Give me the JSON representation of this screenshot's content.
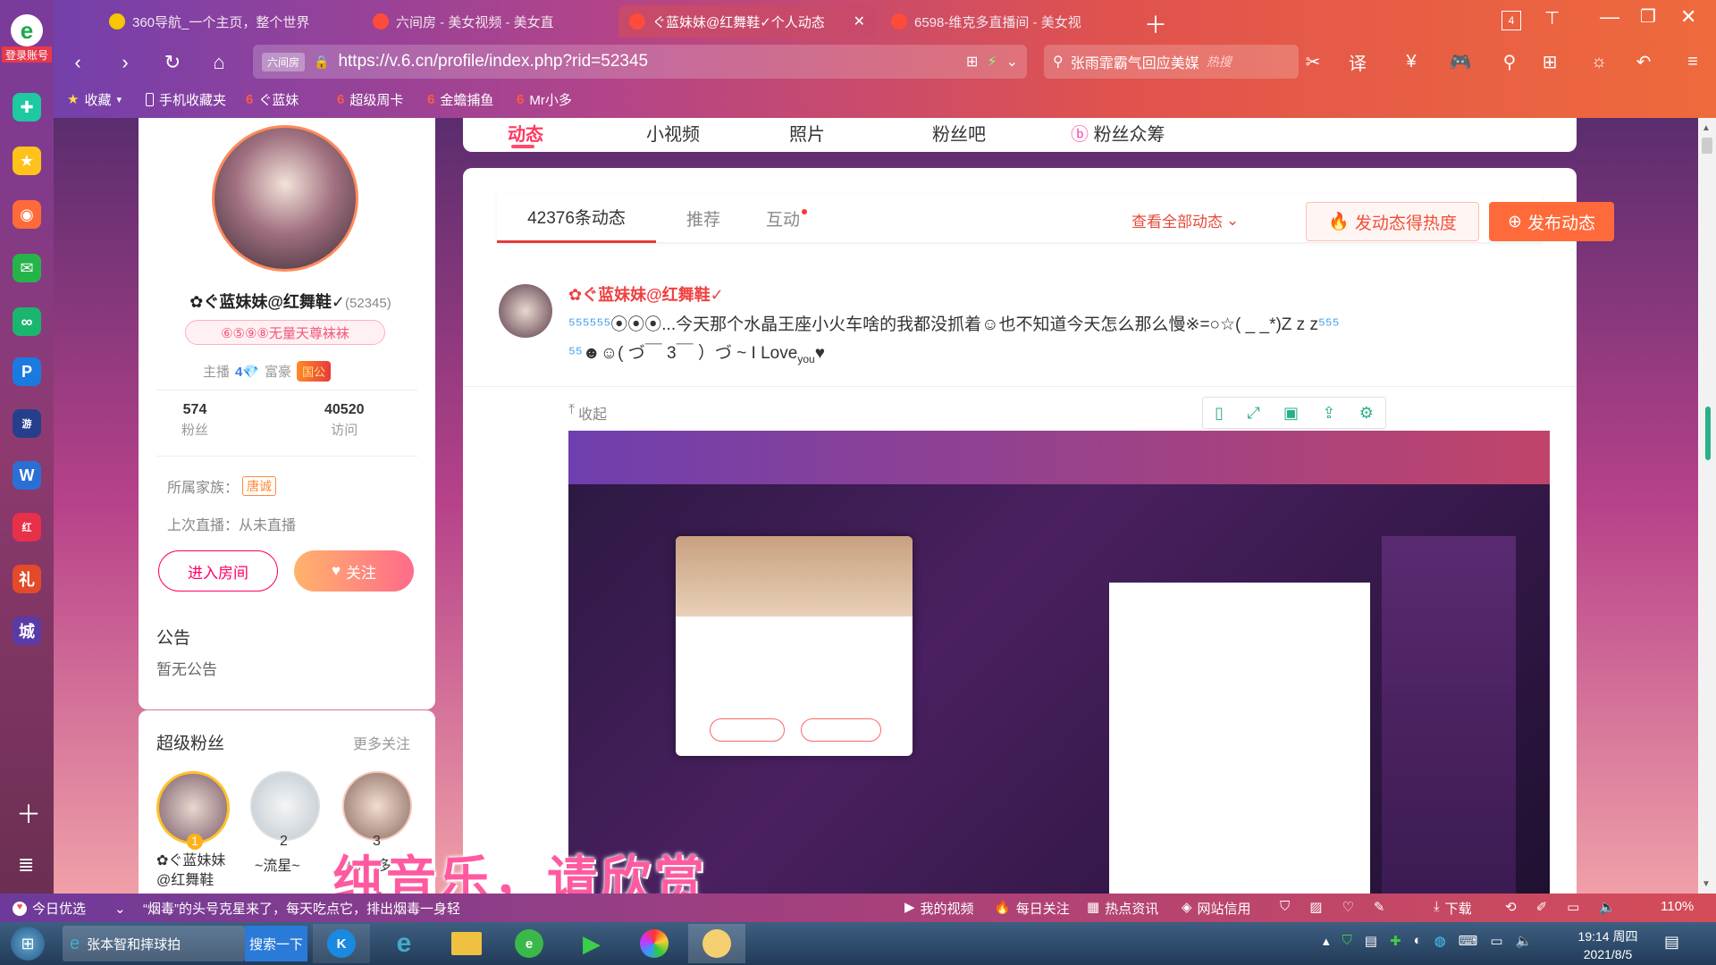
{
  "browser": {
    "login_label": "登录账号",
    "tabs": [
      {
        "title": "360导航_一个主页，整个世界"
      },
      {
        "title": "六间房 - 美女视频 - 美女直"
      },
      {
        "title": "ぐ蓝妹妹@红舞鞋✓个人动态"
      },
      {
        "title": "6598-维克多直播间 - 美女视"
      }
    ],
    "tab_count": "4",
    "url": "https://v.6.cn/profile/index.php?rid=52345",
    "url_badge": "六间房",
    "search_text": "张雨霏霸气回应美媒",
    "search_badge": "热搜",
    "zoom": "110%",
    "bookmarks": [
      "收藏",
      "手机收藏夹",
      "ぐ蓝妹",
      "超级周卡",
      "金蟾捕鱼",
      "Mr小多"
    ]
  },
  "profile_tabs": [
    "动态",
    "小视频",
    "照片",
    "粉丝吧",
    "粉丝众筹"
  ],
  "profile": {
    "name": "✿ぐ蓝妹妹@红舞鞋✓",
    "rid": "(52345)",
    "title_badge": "⑥⑤⑨⑧无量天尊袜袜",
    "anchor_label": "主播",
    "wealth_label": "富豪",
    "wealth_badge": "国公",
    "fans_count": "574",
    "fans_label": "粉丝",
    "visits_count": "40520",
    "visits_label": "访问",
    "family_label": "所属家族：",
    "family_badge": "唐诚",
    "last_live": "上次直播：从未直播",
    "enter_room": "进入房间",
    "follow": "关注"
  },
  "notice": {
    "title": "公告",
    "content": "暂无公告"
  },
  "super_fans": {
    "title": "超级粉丝",
    "more": "更多关注",
    "fans": [
      {
        "rank": "1",
        "name": "✿ぐ蓝妹妹@红舞鞋"
      },
      {
        "rank": "2",
        "name": "~流星~"
      },
      {
        "rank": "3",
        "name": "Mr小多"
      }
    ]
  },
  "feed": {
    "tabs": [
      "42376条动态",
      "推荐",
      "互动"
    ],
    "view_all": "查看全部动态",
    "hot_btn": "发动态得热度",
    "post_btn": "发布动态",
    "post_user": "✿ぐ蓝妹妹@红舞鞋✓",
    "post_text1": "...今天那个水晶王座小火车啥的我都没抓着",
    "post_text2": "也不知道今天怎么那么慢※=○☆( _ _*)Z z z",
    "post_text3": "( づ￣ 3￣ ）づ ~ I  Love",
    "post_text3b": "you",
    "collapse": "收起"
  },
  "subtitle": "纯音乐，请欣赏",
  "statusbar": {
    "left": "今日优选",
    "news": "“烟毒”的头号克星来了，每天吃点它，排出烟毒一身轻",
    "items": [
      "我的视频",
      "每日关注",
      "热点资讯",
      "网站信用",
      "下载"
    ]
  },
  "taskbar": {
    "search_text": "张本智和摔球拍",
    "search_btn": "搜索一下",
    "time": "19:14 周四",
    "date": "2021/8/5"
  },
  "colors": {
    "accent": "#ff4a6e",
    "primary_red": "#f04040"
  }
}
